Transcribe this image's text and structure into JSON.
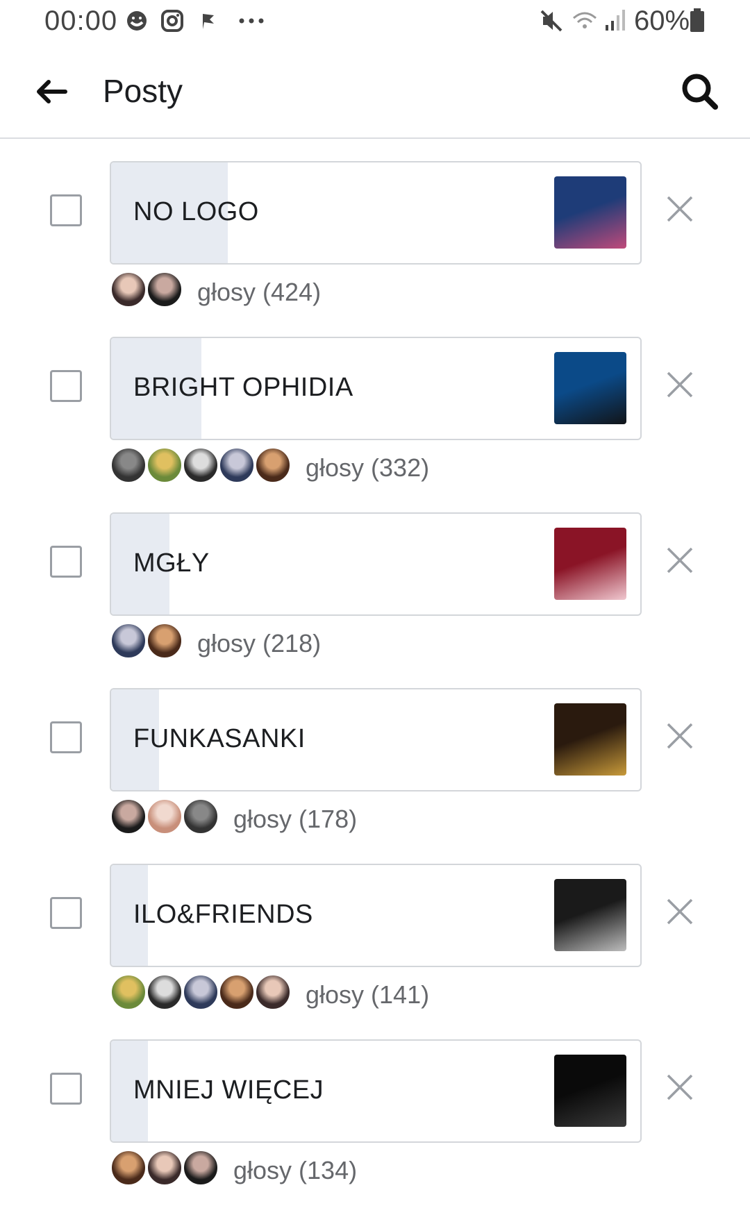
{
  "status_bar": {
    "time": "00:00",
    "battery_percent": "60%",
    "icons": [
      "messenger-icon",
      "instagram-icon",
      "flag-icon",
      "more-dots-icon",
      "mute-icon",
      "wifi-icon",
      "signal-icon",
      "battery-icon"
    ]
  },
  "app_bar": {
    "title": "Posty",
    "back_icon": "arrow-left-icon",
    "search_icon": "search-icon"
  },
  "poll": {
    "options": [
      {
        "label": "NO LOGO",
        "votes": "głosy (424)",
        "share": 0.22,
        "voter_count": 2,
        "thumb_colors": [
          "#1e3c78",
          "#c04a7a"
        ]
      },
      {
        "label": "BRIGHT OPHIDIA",
        "votes": "głosy (332)",
        "share": 0.17,
        "voter_count": 5,
        "thumb_colors": [
          "#0b4a88",
          "#111418"
        ]
      },
      {
        "label": "MGŁY",
        "votes": "głosy (218)",
        "share": 0.11,
        "voter_count": 2,
        "thumb_colors": [
          "#8a1426",
          "#f0c8d0"
        ]
      },
      {
        "label": "FUNKASANKI",
        "votes": "głosy (178)",
        "share": 0.09,
        "voter_count": 3,
        "thumb_colors": [
          "#2a1a0e",
          "#c89a3a"
        ]
      },
      {
        "label": "ILO&FRIENDS",
        "votes": "głosy (141)",
        "share": 0.07,
        "voter_count": 5,
        "thumb_colors": [
          "#1a1a1a",
          "#bdbdbd"
        ]
      },
      {
        "label": "MNIEJ WIĘCEJ",
        "votes": "głosy (134)",
        "share": 0.07,
        "voter_count": 3,
        "thumb_colors": [
          "#0a0a0a",
          "#3a3a3a"
        ]
      }
    ]
  },
  "colors": {
    "fill": "#e7ebf2",
    "border": "#d3d6da",
    "secondary_text": "#65676b"
  }
}
